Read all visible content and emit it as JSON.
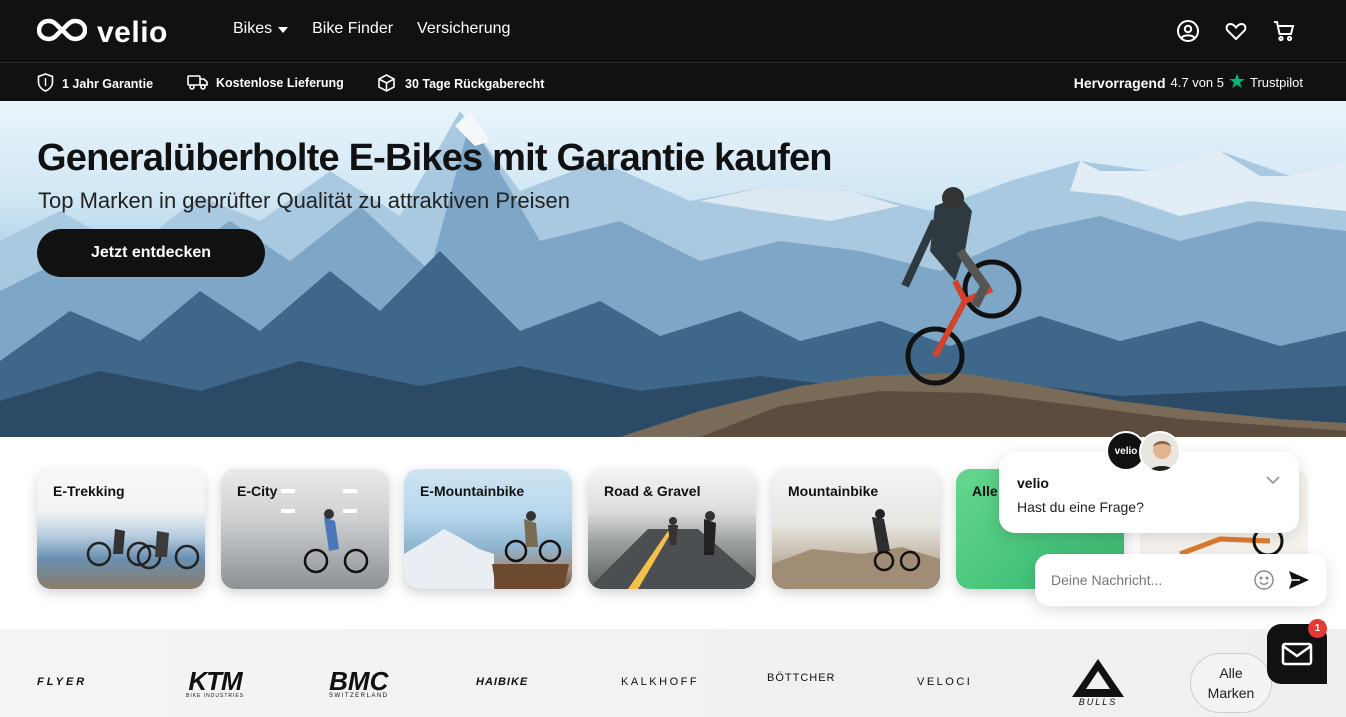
{
  "header": {
    "logo_text": "velio",
    "nav": [
      {
        "label": "Bikes",
        "has_dropdown": true
      },
      {
        "label": "Bike Finder"
      },
      {
        "label": "Versicherung"
      }
    ],
    "icons": [
      "user-icon",
      "heart-icon",
      "cart-icon"
    ]
  },
  "usp_bar": {
    "items": [
      {
        "icon": "shield-icon",
        "label": "1 Jahr Garantie"
      },
      {
        "icon": "truck-icon",
        "label": "Kostenlose Lieferung"
      },
      {
        "icon": "box-return-icon",
        "label": "30 Tage Rückgaberecht"
      }
    ],
    "trustpilot": {
      "rating_word": "Hervorragend",
      "score": "4.7 von 5",
      "brand": "Trustpilot",
      "star_color": "#00b67a"
    }
  },
  "hero": {
    "title": "Generalüberholte E-Bikes mit Garantie kaufen",
    "subtitle": "Top Marken in geprüfter Qualität zu attraktiven Preisen",
    "cta": "Jetzt entdecken"
  },
  "categories": [
    {
      "label": "E-Trekking"
    },
    {
      "label": "E-City"
    },
    {
      "label": "E-Mountainbike"
    },
    {
      "label": "Road & Gravel"
    },
    {
      "label": "Mountainbike"
    },
    {
      "label": "Alle"
    }
  ],
  "brands": {
    "items": [
      "FLYER",
      "KTM",
      "BIKE INDUSTRIES",
      "BMC",
      "SWITZERLAND",
      "HAIBIKE",
      "KALKHOFF",
      "BÖTTCHER",
      "VELOCI",
      "BULLS"
    ],
    "all_line1": "Alle",
    "all_line2": "Marken"
  },
  "chat": {
    "avatar_text": "velio",
    "sender": "velio",
    "message": "Hast du eine Frage?",
    "input_placeholder": "Deine Nachricht...",
    "badge_count": "1"
  },
  "colors": {
    "dark": "#111111",
    "accent_green": "#00b67a",
    "badge_red": "#e53935"
  }
}
